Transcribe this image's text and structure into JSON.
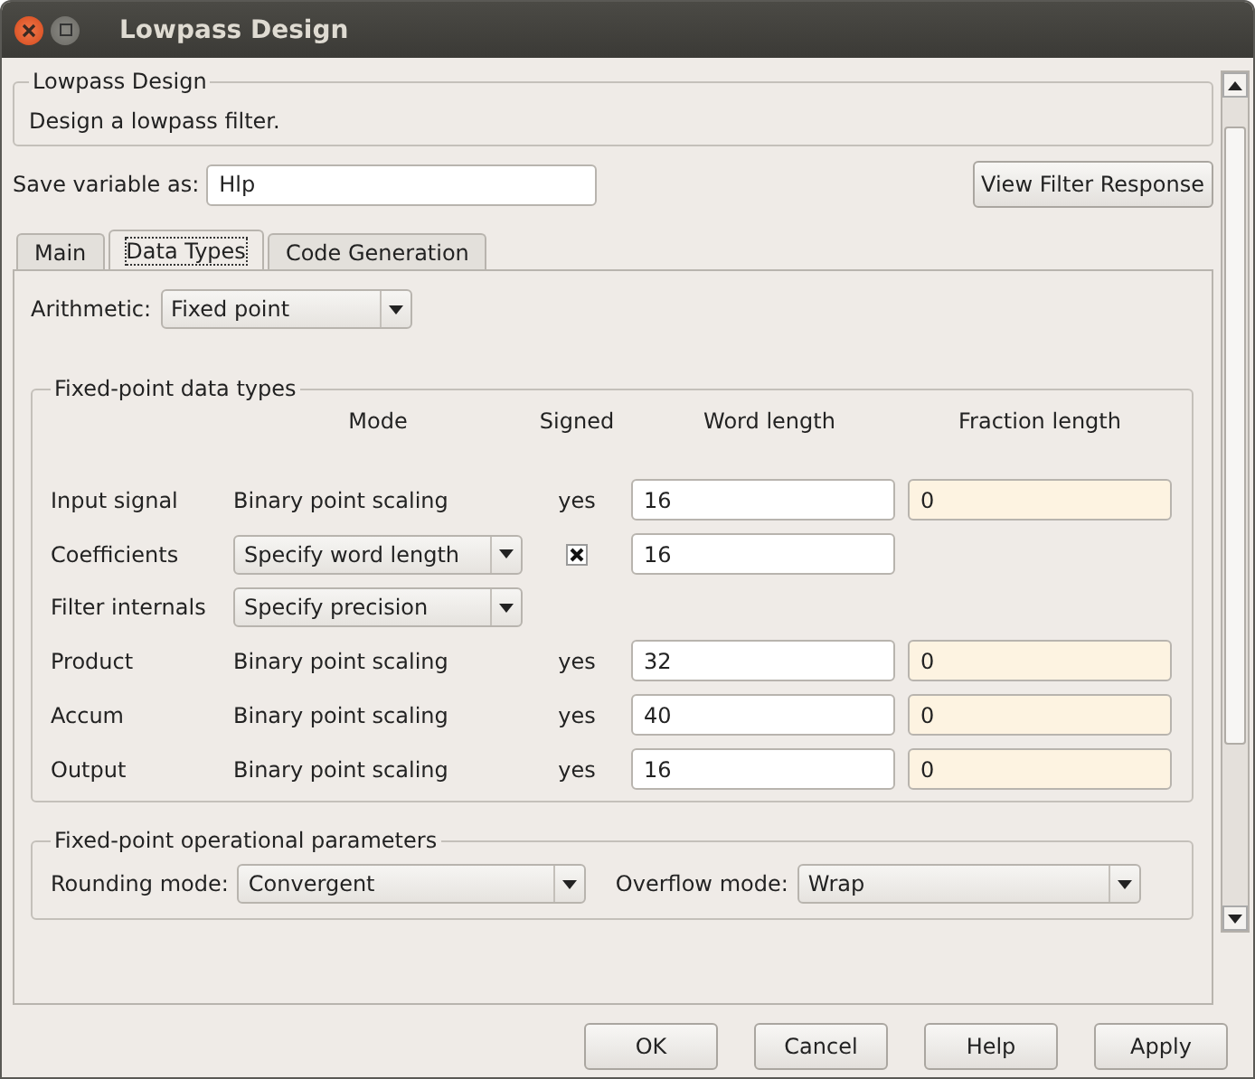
{
  "window": {
    "title": "Lowpass Design"
  },
  "description": {
    "title": "Lowpass Design",
    "text": "Design a lowpass filter."
  },
  "save_variable": {
    "label": "Save variable as:",
    "value": "Hlp"
  },
  "view_button": "View Filter Response",
  "tabs": [
    {
      "label": "Main",
      "selected": false
    },
    {
      "label": "Data Types",
      "selected": true
    },
    {
      "label": "Code Generation",
      "selected": false
    }
  ],
  "arithmetic": {
    "label": "Arithmetic:",
    "value": "Fixed point"
  },
  "data_types": {
    "title": "Fixed-point data types",
    "columns": [
      "Mode",
      "Signed",
      "Word length",
      "Fraction length"
    ],
    "rows": [
      {
        "label": "Input signal",
        "mode": {
          "kind": "text",
          "value": "Binary point scaling"
        },
        "signed": {
          "kind": "text",
          "value": "yes"
        },
        "word_length": "16",
        "fraction_length": "0"
      },
      {
        "label": "Coefficients",
        "mode": {
          "kind": "dropdown",
          "value": "Specify word length"
        },
        "signed": {
          "kind": "checkbox",
          "checked": true
        },
        "word_length": "16"
      },
      {
        "label": "Filter internals",
        "mode": {
          "kind": "dropdown",
          "value": "Specify precision"
        }
      },
      {
        "label": "Product",
        "mode": {
          "kind": "text",
          "value": "Binary point scaling"
        },
        "signed": {
          "kind": "text",
          "value": "yes"
        },
        "word_length": "32",
        "fraction_length": "0"
      },
      {
        "label": "Accum",
        "mode": {
          "kind": "text",
          "value": "Binary point scaling"
        },
        "signed": {
          "kind": "text",
          "value": "yes"
        },
        "word_length": "40",
        "fraction_length": "0"
      },
      {
        "label": "Output",
        "mode": {
          "kind": "text",
          "value": "Binary point scaling"
        },
        "signed": {
          "kind": "text",
          "value": "yes"
        },
        "word_length": "16",
        "fraction_length": "0"
      }
    ]
  },
  "operational": {
    "title": "Fixed-point operational parameters",
    "rounding_label": "Rounding mode:",
    "rounding": "Convergent",
    "overflow_label": "Overflow mode:",
    "overflow": "Wrap"
  },
  "buttons": [
    "OK",
    "Cancel",
    "Help",
    "Apply"
  ]
}
